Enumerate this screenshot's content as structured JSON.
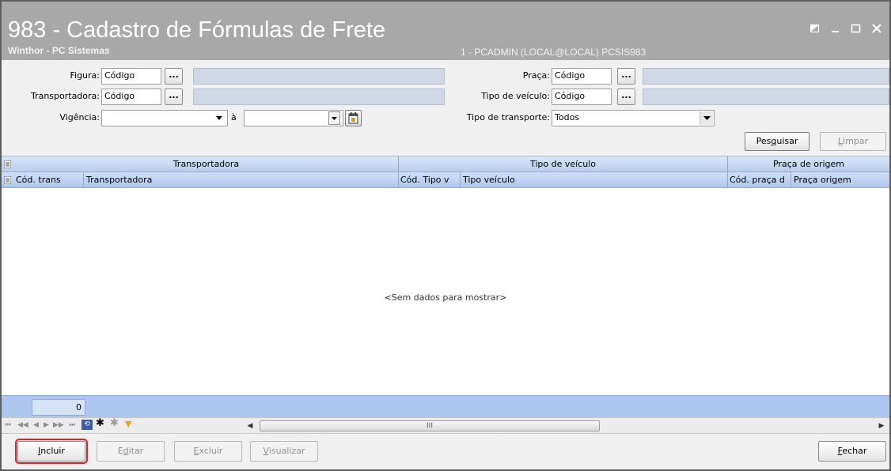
{
  "window": {
    "title": "983 - Cadastro de Fórmulas de Frete",
    "subtitle": "Winthor - PC Sistemas",
    "user_info": "1 - PCADMIN (LOCAL@LOCAL)   PCSIS983"
  },
  "filters": {
    "figura_label": "Figura:",
    "figura_value": "Código",
    "transportadora_label": "Transportadora:",
    "transportadora_value": "Código",
    "vigencia_label": "Vigência:",
    "vigencia_value": "",
    "vigencia_sep": "à",
    "vigencia_end_value": "",
    "praca_label": "Praça:",
    "praca_value": "Código",
    "tipo_veiculo_label": "Tipo de veículo:",
    "tipo_veiculo_value": "Código",
    "tipo_transporte_label": "Tipo de transporte:",
    "tipo_transporte_value": "Todos",
    "dots_label": "...",
    "pesquisar_u": "Pes",
    "pesquisar_a": "q",
    "pesquisar_b": "uisar",
    "limpar_u": "L",
    "limpar_rest": "impar"
  },
  "grid": {
    "bands": [
      "Transportadora",
      "Tipo de veículo",
      "Praça de origem"
    ],
    "columns": [
      "Cód. trans",
      "Transportadora",
      "Cód. Tipo v",
      "Tipo veículo",
      "Cód. praça d",
      "Praça origem"
    ],
    "empty_message": "<Sem dados para mostrar>",
    "record_count": "0"
  },
  "navigator": {
    "scroll_label": "III"
  },
  "buttons": {
    "incluir_u": "I",
    "incluir_rest": "ncluir",
    "editar_a": "E",
    "editar_u": "d",
    "editar_b": "itar",
    "excluir_u": "E",
    "excluir_rest": "xcluir",
    "visualizar_u": "V",
    "visualizar_rest": "isualizar",
    "fechar_u": "F",
    "fechar_rest": "echar"
  },
  "colors": {
    "titlebar": "#a8a8a8",
    "grid_header": "#b9cfee",
    "highlight": "#e02020"
  }
}
